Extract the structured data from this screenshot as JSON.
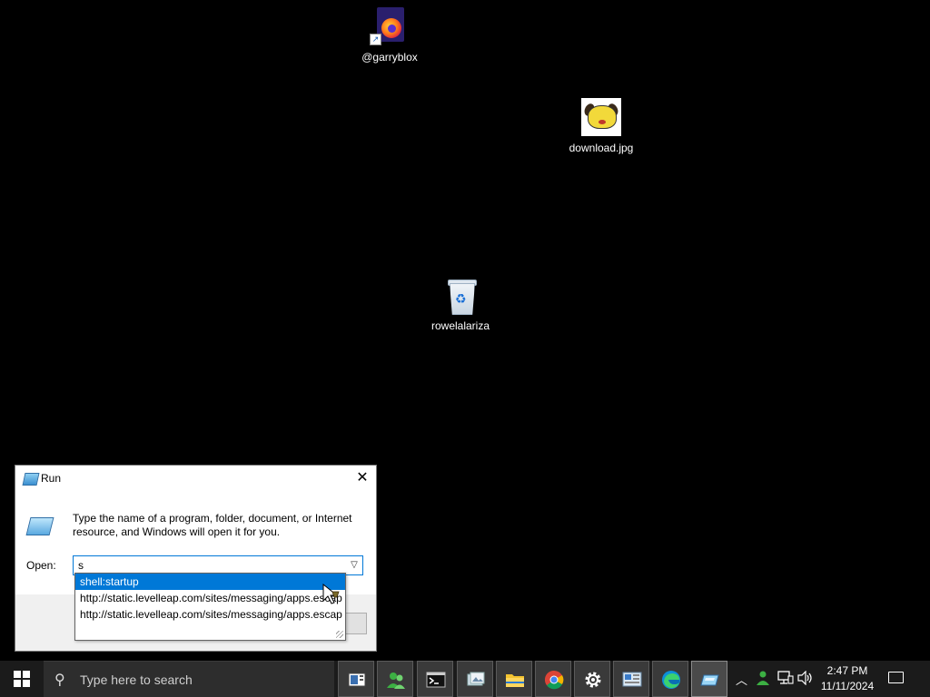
{
  "desktop": {
    "icons": [
      {
        "label": "@garryblox",
        "icon": "firefox-shortcut-icon"
      },
      {
        "label": "download.jpg",
        "icon": "image-file-icon"
      },
      {
        "label": "rowelalariza",
        "icon": "recycle-bin-icon"
      }
    ]
  },
  "run_dialog": {
    "title": "Run",
    "close_glyph": "✕",
    "description": "Type the name of a program, folder, document, or Internet resource, and Windows will open it for you.",
    "open_label": "Open:",
    "open_value": "s",
    "suggestions": [
      {
        "text": "shell:startup",
        "selected": true
      },
      {
        "text": "http://static.levelleap.com/sites/messaging/apps.escap",
        "selected": false
      },
      {
        "text": "http://static.levelleap.com/sites/messaging/apps.escap",
        "selected": false
      }
    ]
  },
  "taskbar": {
    "search_placeholder": "Type here to search",
    "apps": [
      {
        "name": "task-view",
        "icon": "task-view-icon"
      },
      {
        "name": "people",
        "icon": "people-icon"
      },
      {
        "name": "terminal",
        "icon": "terminal-icon"
      },
      {
        "name": "photos",
        "icon": "photos-icon"
      },
      {
        "name": "file-explorer",
        "icon": "folder-icon"
      },
      {
        "name": "chrome",
        "icon": "chrome-icon"
      },
      {
        "name": "settings",
        "icon": "gear-icon"
      },
      {
        "name": "control-panel",
        "icon": "control-panel-icon"
      },
      {
        "name": "edge",
        "icon": "edge-icon"
      },
      {
        "name": "run",
        "icon": "run-icon"
      }
    ],
    "tray": {
      "chevron": "^",
      "time": "2:47 PM",
      "date": "11/11/2024"
    }
  }
}
